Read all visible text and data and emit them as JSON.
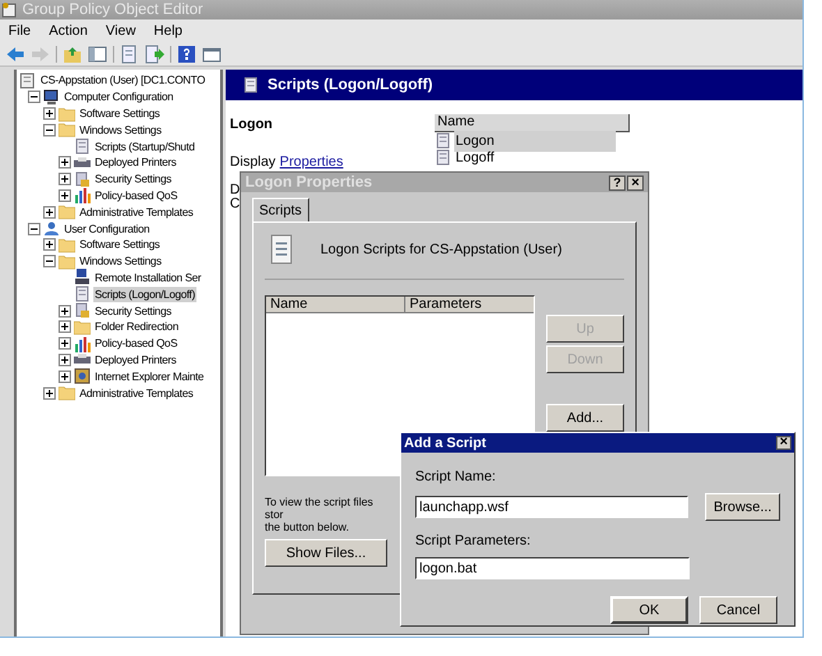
{
  "window": {
    "title": "Group Policy Object Editor"
  },
  "menu": [
    "File",
    "Action",
    "View",
    "Help"
  ],
  "toolbar": [
    {
      "kind": "back",
      "disabled": false
    },
    {
      "kind": "forward",
      "disabled": true
    },
    {
      "kind": "up",
      "disabled": false
    },
    {
      "kind": "pane",
      "disabled": false
    },
    {
      "kind": "export",
      "disabled": false
    },
    {
      "kind": "refresh",
      "disabled": false
    },
    {
      "kind": "help",
      "disabled": false
    },
    {
      "kind": "window",
      "disabled": false
    }
  ],
  "tree": [
    {
      "label": "CS-Appstation (User) [DC1.CONTO",
      "kind": "gpo",
      "selected": false,
      "children": [
        {
          "label": "Computer Configuration",
          "kind": "computer",
          "selected": false,
          "expanded": true,
          "children": [
            {
              "label": "Software Settings",
              "kind": "folder",
              "selected": false,
              "expanded": false
            },
            {
              "label": "Windows Settings",
              "kind": "folder",
              "selected": false,
              "expanded": true,
              "children": [
                {
                  "label": "Scripts (Startup/Shutd",
                  "kind": "script",
                  "selected": false
                },
                {
                  "label": "Deployed Printers",
                  "kind": "printer",
                  "selected": false,
                  "expanded": false
                },
                {
                  "label": "Security Settings",
                  "kind": "security",
                  "selected": false,
                  "expanded": false
                },
                {
                  "label": "Policy-based QoS",
                  "kind": "chart",
                  "selected": false,
                  "expanded": false
                }
              ]
            },
            {
              "label": "Administrative Templates",
              "kind": "folder",
              "selected": false,
              "expanded": false
            }
          ]
        },
        {
          "label": "User Configuration",
          "kind": "user",
          "selected": false,
          "expanded": true,
          "children": [
            {
              "label": "Software Settings",
              "kind": "folder",
              "selected": false,
              "expanded": false
            },
            {
              "label": "Windows Settings",
              "kind": "folder",
              "selected": false,
              "expanded": true,
              "children": [
                {
                  "label": "Remote Installation Ser",
                  "kind": "remote",
                  "selected": false
                },
                {
                  "label": "Scripts (Logon/Logoff)",
                  "kind": "script",
                  "selected": true
                },
                {
                  "label": "Security Settings",
                  "kind": "security",
                  "selected": false,
                  "expanded": false
                },
                {
                  "label": "Folder Redirection",
                  "kind": "folder",
                  "selected": false,
                  "expanded": false
                },
                {
                  "label": "Policy-based QoS",
                  "kind": "chart",
                  "selected": false,
                  "expanded": false
                },
                {
                  "label": "Deployed Printers",
                  "kind": "printer",
                  "selected": false,
                  "expanded": false
                },
                {
                  "label": "Internet Explorer Mainte",
                  "kind": "ie",
                  "selected": false,
                  "expanded": false
                }
              ]
            },
            {
              "label": "Administrative Templates",
              "kind": "folder",
              "selected": false,
              "expanded": false
            }
          ]
        }
      ]
    }
  ],
  "details": {
    "header": "Scripts (Logon/Logoff)",
    "heading": "Logon",
    "display_text": "Display",
    "link": "Properties",
    "cut_lines": [
      "D",
      "C"
    ],
    "column": "Name",
    "items": [
      {
        "label": "Logon",
        "selected": true
      },
      {
        "label": "Logoff",
        "selected": false
      }
    ]
  },
  "logon_properties": {
    "title": "Logon Properties",
    "help": "?",
    "close": "×",
    "tabs": [
      {
        "label": "Scripts",
        "selected": true
      }
    ],
    "caption": "Logon Scripts for CS-Appstation (User)",
    "columns": [
      "Name",
      "Parameters"
    ],
    "buttons": [
      {
        "label": "Up",
        "disabled": true
      },
      {
        "label": "Down",
        "disabled": true
      },
      {
        "label": "Add...",
        "disabled": false
      }
    ],
    "note_lines": [
      "To view the script files stor",
      "the button below."
    ],
    "show_files": "Show Files..."
  },
  "add_script": {
    "title": "Add a Script",
    "close": "×",
    "name_label": "Script Name:",
    "name_value": "launchapp.wsf",
    "browse": "Browse...",
    "params_label": "Script Parameters:",
    "params_value": "logon.bat",
    "ok": "OK",
    "cancel": "Cancel"
  }
}
